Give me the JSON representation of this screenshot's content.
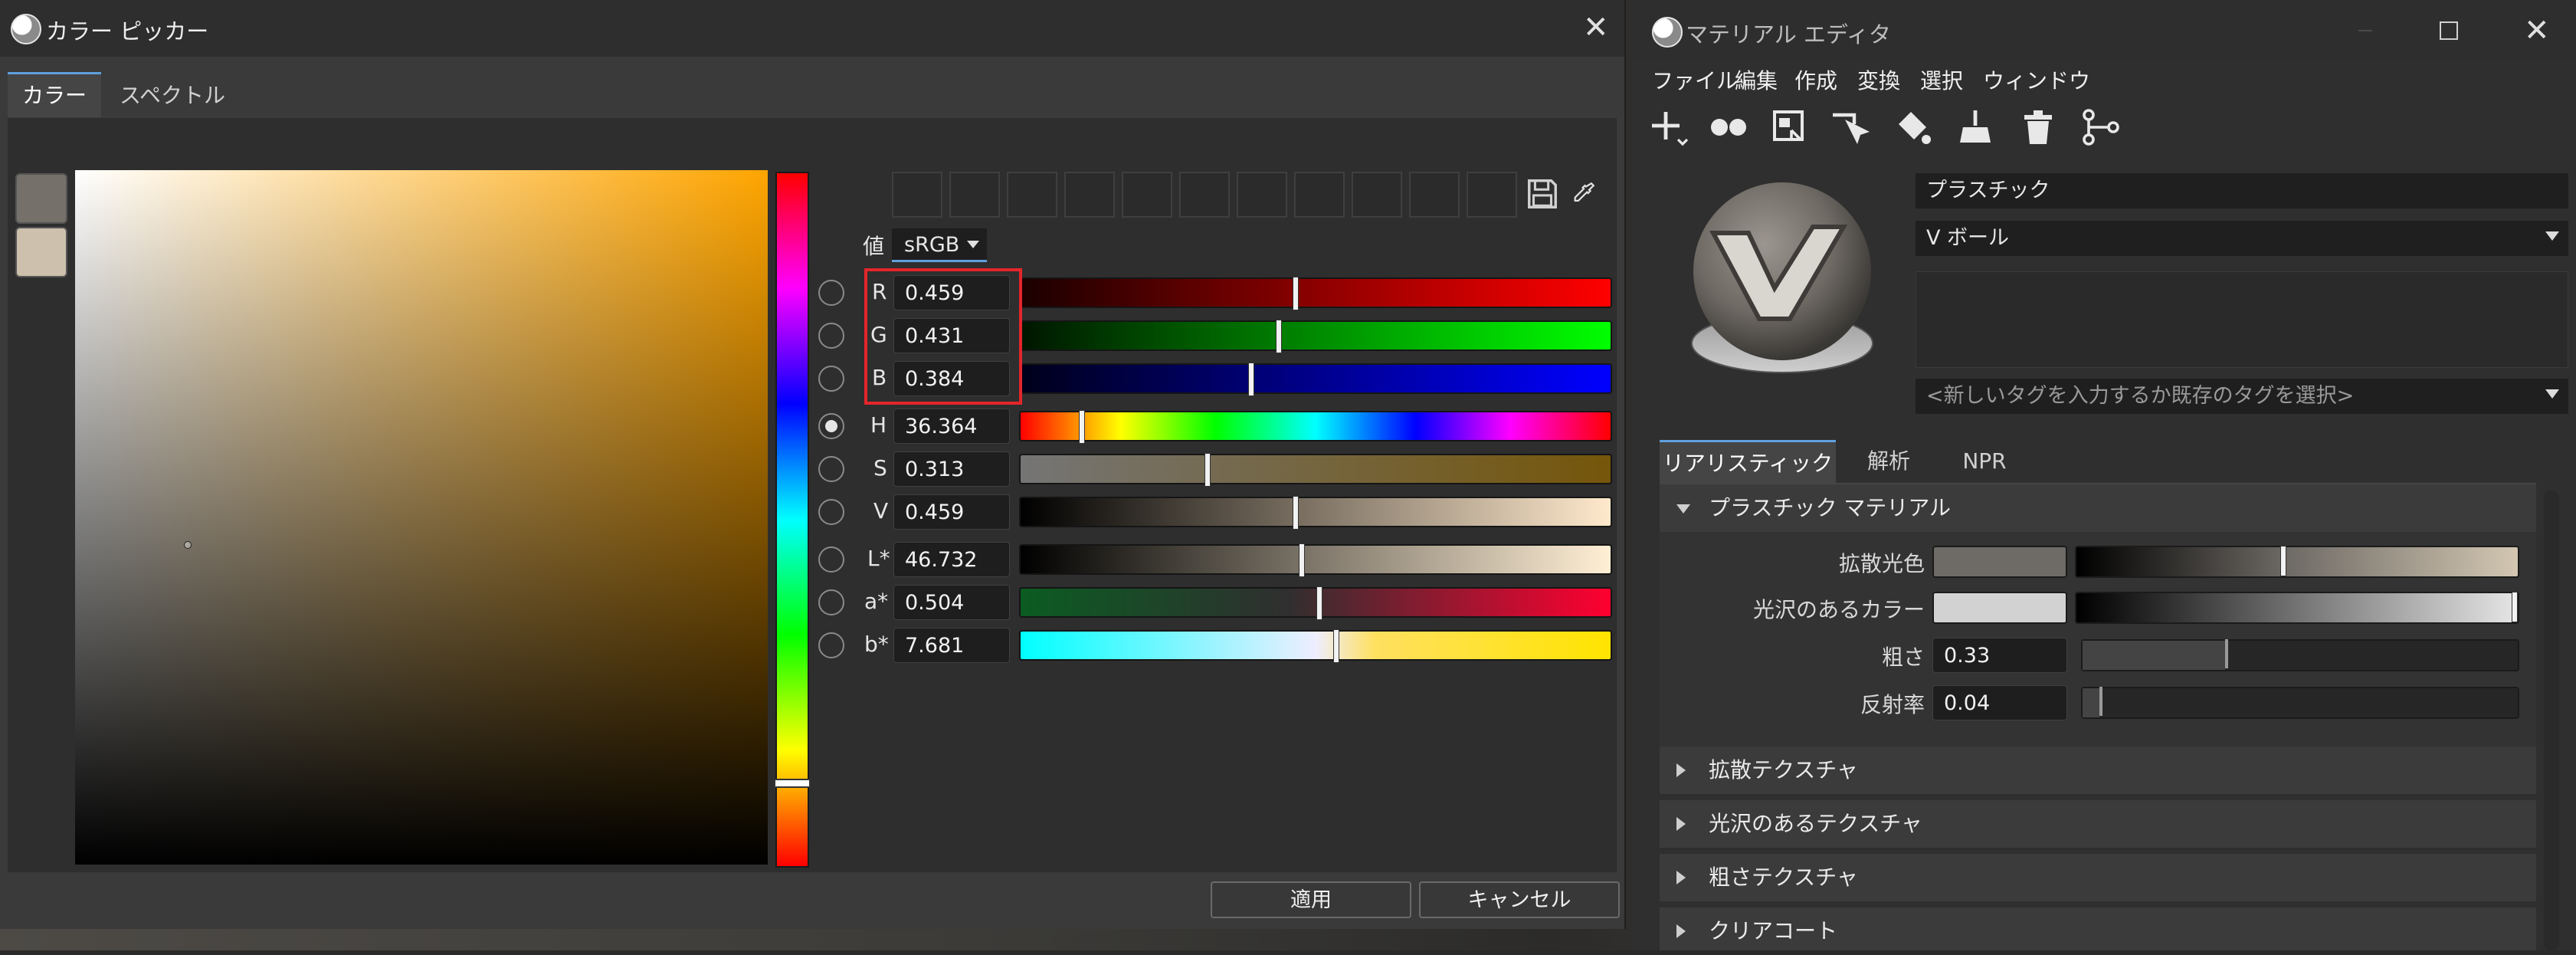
{
  "color_picker": {
    "title": "カラー ピッカー",
    "tabs": [
      "カラー",
      "スペクトル"
    ],
    "value_label": "値",
    "color_space": "sRGB",
    "channels": [
      {
        "label": "R",
        "value": "0.459"
      },
      {
        "label": "G",
        "value": "0.431"
      },
      {
        "label": "B",
        "value": "0.384"
      },
      {
        "label": "H",
        "value": "36.364"
      },
      {
        "label": "S",
        "value": "0.313"
      },
      {
        "label": "V",
        "value": "0.459"
      },
      {
        "label": "L*",
        "value": "46.732"
      },
      {
        "label": "a*",
        "value": "0.504"
      },
      {
        "label": "b*",
        "value": "7.681"
      }
    ],
    "selected_channel": "H",
    "current_color": "#75706a",
    "previous_color": "#cdc0ac",
    "apply_button": "適用",
    "cancel_button": "キャンセル"
  },
  "material_editor": {
    "title": "マテリアル エディタ",
    "menu": [
      "ファイル",
      "編集",
      "作成",
      "変換",
      "選択",
      "ウィンドウ"
    ],
    "toolbar_icons": [
      "add-icon",
      "material-balls-icon",
      "assign-icon",
      "pick-icon",
      "paint-bucket-icon",
      "broom-icon",
      "trash-icon",
      "graph-icon"
    ],
    "name": "プラスチック",
    "type": "V ボール",
    "tags_placeholder": "<新しいタグを入力するか既存のタグを選択>",
    "tabs": [
      "リアリスティック",
      "解析",
      "NPR"
    ],
    "sections": {
      "plastic_material": "プラスチック マテリアル",
      "diffuse_texture": "拡散テクスチャ",
      "gloss_texture": "光沢のあるテクスチャ",
      "roughness_texture": "粗さテクスチャ",
      "clear_coat": "クリアコート"
    },
    "properties": {
      "diffuse_label": "拡散光色",
      "gloss_label": "光沢のあるカラー",
      "roughness_label": "粗さ",
      "roughness_value": "0.33",
      "reflectivity_label": "反射率",
      "reflectivity_value": "0.04"
    },
    "diffuse_color": "#6e6a65",
    "gloss_color": "#d2d2d2"
  }
}
